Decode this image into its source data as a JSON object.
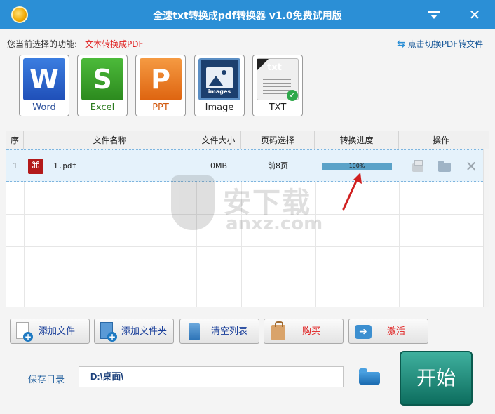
{
  "window": {
    "title": "全速txt转换成pdf转换器 v1.0免费试用版",
    "min_glyph": "",
    "close_glyph": "✕"
  },
  "function_bar": {
    "label": "您当前选择的功能:",
    "value": "文本转换成PDF",
    "switch_link": "点击切换PDF转文件",
    "switch_icon": "⇆"
  },
  "formats": [
    {
      "label": "Word",
      "glyph": "W",
      "icon": "word-icon",
      "color": "#2b5fc8"
    },
    {
      "label": "Excel",
      "glyph": "S",
      "icon": "excel-icon",
      "color": "#3a9a2a"
    },
    {
      "label": "PPT",
      "glyph": "P",
      "icon": "ppt-icon",
      "color": "#e8782a"
    },
    {
      "label": "Image",
      "glyph": "images",
      "icon": "image-icon",
      "color": "#1c3f6e"
    },
    {
      "label": "TXT",
      "glyph": "txt",
      "icon": "txt-icon",
      "color": "#333333"
    }
  ],
  "table": {
    "headers": [
      "序",
      "文件名称",
      "文件大小",
      "页码选择",
      "转换进度",
      "操作"
    ],
    "rows": [
      {
        "index": "1",
        "name": "1.pdf",
        "size": "0MB",
        "pages": "前8页",
        "progress_text": "100%",
        "progress": 1.0
      }
    ]
  },
  "actions": {
    "add_file": "添加文件",
    "add_folder": "添加文件夹",
    "clear_list": "清空列表",
    "buy": "购买",
    "activate": "激活"
  },
  "save": {
    "label": "保存目录",
    "path": "D:\\桌面\\"
  },
  "start_button": "开始",
  "watermark": {
    "cn": "安下载",
    "en": "anxz.com"
  },
  "colors": {
    "titlebar": "#2b8fd6",
    "accent_red": "#e02020",
    "start_button": "#1a8a7a"
  }
}
